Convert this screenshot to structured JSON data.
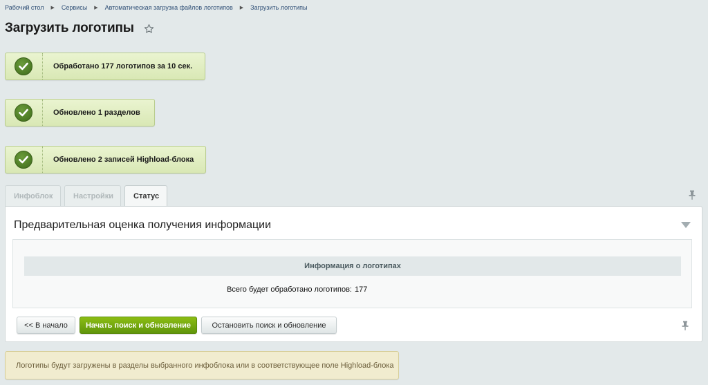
{
  "breadcrumb": {
    "items": [
      "Рабочий стол",
      "Сервисы",
      "Автоматическая загрузка файлов логотипов",
      "Загрузить логотипы"
    ]
  },
  "page": {
    "title": "Загрузить логотипы"
  },
  "messages": [
    "Обработано 177 логотипов за 10 сек.",
    "Обновлено 1 разделов",
    "Обновлено 2 записей Highload-блока"
  ],
  "tabs": [
    {
      "label": "Инфоблок",
      "active": false
    },
    {
      "label": "Настройки",
      "active": false
    },
    {
      "label": "Статус",
      "active": true
    }
  ],
  "panel": {
    "heading": "Предварительная оценка получения информации",
    "info_header": "Информация о логотипах",
    "total_label": "Всего будет обработано логотипов:",
    "total_value": "177"
  },
  "buttons": {
    "back": "<< В начало",
    "start": "Начать поиск и обновление",
    "stop": "Остановить поиск и обновление"
  },
  "note": "Логотипы будут загружены в разделы выбранного инфоблока или в соответствующее поле Highload-блока",
  "icons": {
    "success": "check-icon",
    "favorite": "star-icon",
    "pin": "pin-icon",
    "collapse": "triangle-down-icon"
  },
  "colors": {
    "accent_green": "#6ea70f",
    "success_bg": "#dfecbf",
    "note_bg": "#f1eccf"
  }
}
